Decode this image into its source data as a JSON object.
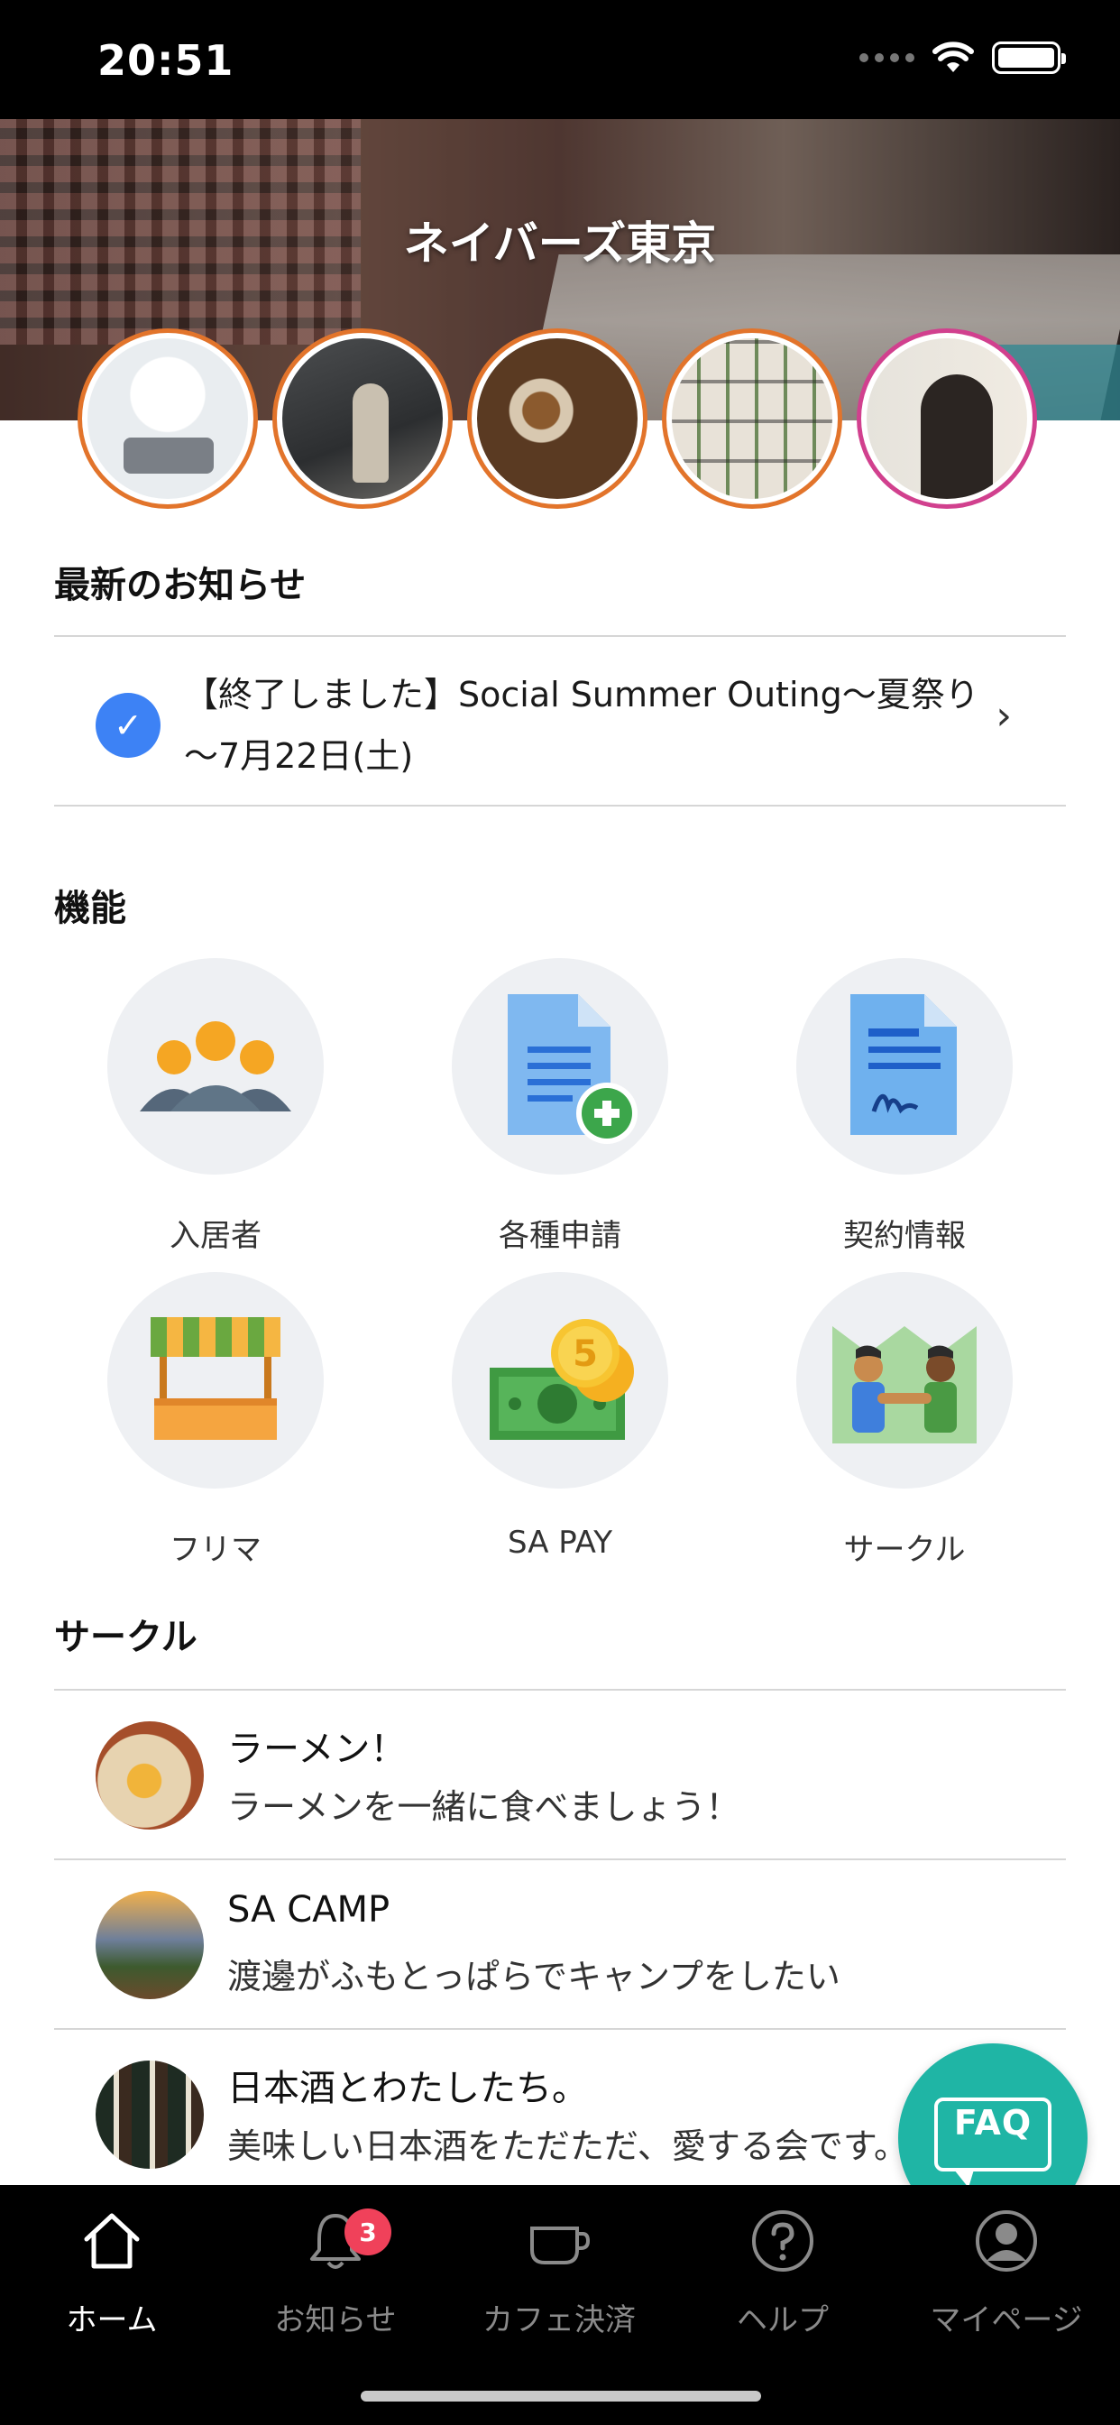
{
  "status_bar": {
    "time": "20:51"
  },
  "hero": {
    "title": "ネイバーズ東京"
  },
  "news": {
    "section_title": "最新のお知らせ",
    "items": [
      {
        "text": "【終了しました】Social Summer Outing～夏祭り～7月22日(土)"
      }
    ]
  },
  "features": {
    "section_title": "機能",
    "items": [
      {
        "label": "入居者",
        "icon": "residents-icon"
      },
      {
        "label": "各種申請",
        "icon": "application-icon"
      },
      {
        "label": "契約情報",
        "icon": "contract-icon"
      },
      {
        "label": "フリマ",
        "icon": "flea-market-icon"
      },
      {
        "label": "SA PAY",
        "icon": "payment-icon"
      },
      {
        "label": "サークル",
        "icon": "circle-icon"
      }
    ]
  },
  "circles": {
    "section_title": "サークル",
    "items": [
      {
        "name": "ラーメン！",
        "desc": "ラーメンを一緒に食べましょう！"
      },
      {
        "name": "SA CAMP",
        "desc": "渡邊がふもとっぱらでキャンプをしたい"
      },
      {
        "name": "日本酒とわたしたち。",
        "desc": "美味しい日本酒をただただ、愛する会です。"
      }
    ]
  },
  "faq": {
    "label": "FAQ"
  },
  "tabbar": {
    "items": [
      {
        "label": "ホーム",
        "icon": "home-icon"
      },
      {
        "label": "お知らせ",
        "icon": "bell-icon",
        "badge": "3"
      },
      {
        "label": "カフェ決済",
        "icon": "cup-icon"
      },
      {
        "label": "ヘルプ",
        "icon": "help-icon"
      },
      {
        "label": "マイページ",
        "icon": "user-icon"
      }
    ]
  },
  "colors": {
    "accent_blue": "#3d82f5",
    "faq_teal": "#1fb5a5",
    "badge_red": "#f0415a",
    "avatar_ring_orange": "#e2742b",
    "avatar_ring_pink": "#d1408e"
  }
}
